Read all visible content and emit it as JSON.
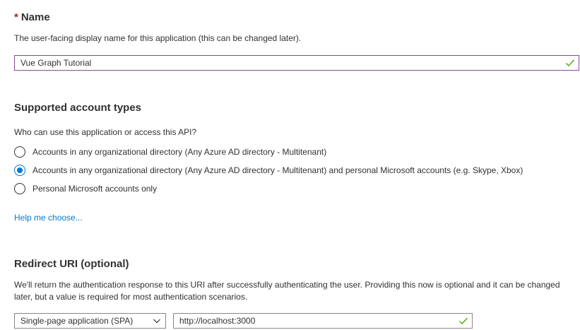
{
  "name_section": {
    "required_marker": "*",
    "title": "Name",
    "description": "The user-facing display name for this application (this can be changed later).",
    "value": "Vue Graph Tutorial"
  },
  "account_types": {
    "title": "Supported account types",
    "question": "Who can use this application or access this API?",
    "options": [
      {
        "label": "Accounts in any organizational directory (Any Azure AD directory - Multitenant)",
        "selected": false
      },
      {
        "label": "Accounts in any organizational directory (Any Azure AD directory - Multitenant) and personal Microsoft accounts (e.g. Skype, Xbox)",
        "selected": true
      },
      {
        "label": "Personal Microsoft accounts only",
        "selected": false
      }
    ],
    "help_link": "Help me choose..."
  },
  "redirect_uri": {
    "title": "Redirect URI (optional)",
    "description": "We'll return the authentication response to this URI after successfully authenticating the user. Providing this now is optional and it can be changed later, but a value is required for most authentication scenarios.",
    "platform_selected": "Single-page application (SPA)",
    "uri_value": "http://localhost:3000"
  },
  "colors": {
    "accent": "#0078d4",
    "valid_check": "#57a300",
    "field_border": "#8a4b9c",
    "required": "#a4262c"
  }
}
